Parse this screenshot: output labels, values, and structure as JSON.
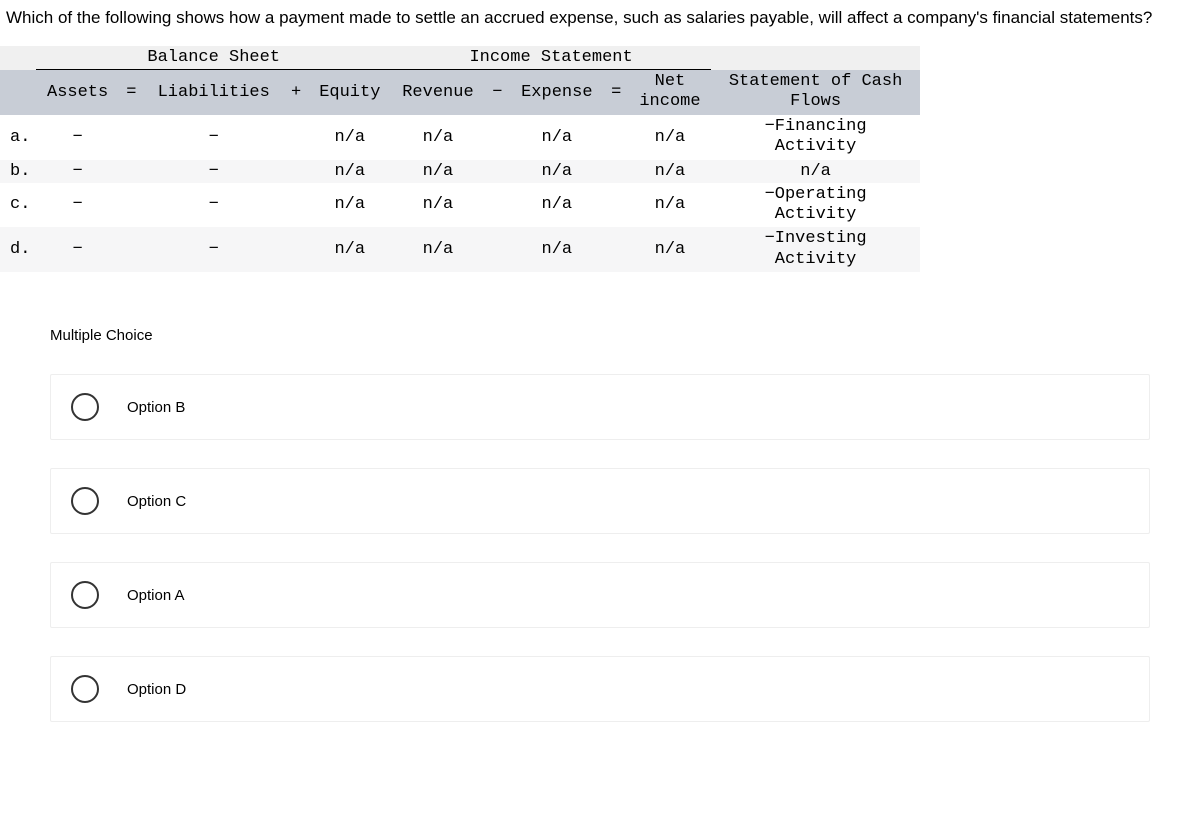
{
  "question": "Which of the following shows how a payment made to settle an accrued expense, such as salaries payable, will affect a company's financial statements?",
  "table": {
    "group_headers": {
      "balance_sheet": "Balance Sheet",
      "income_statement": "Income Statement"
    },
    "columns": {
      "assets": "Assets",
      "eq1": "=",
      "liabilities": "Liabilities",
      "plus": "+",
      "equity": "Equity",
      "revenue": "Revenue",
      "minus": "−",
      "expense": "Expense",
      "eq2": "=",
      "netincome_l1": "Net",
      "netincome_l2": "income",
      "socf_l1": "Statement of Cash",
      "socf_l2": "Flows"
    },
    "rows": [
      {
        "label": "a.",
        "assets": "−",
        "liabilities": "−",
        "equity": "n/a",
        "revenue": "n/a",
        "expense": "n/a",
        "netincome": "n/a",
        "socf_l1": "−Financing",
        "socf_l2": "Activity"
      },
      {
        "label": "b.",
        "assets": "−",
        "liabilities": "−",
        "equity": "n/a",
        "revenue": "n/a",
        "expense": "n/a",
        "netincome": "n/a",
        "socf_l1": "n/a",
        "socf_l2": ""
      },
      {
        "label": "c.",
        "assets": "−",
        "liabilities": "−",
        "equity": "n/a",
        "revenue": "n/a",
        "expense": "n/a",
        "netincome": "n/a",
        "socf_l1": "−Operating",
        "socf_l2": "Activity"
      },
      {
        "label": "d.",
        "assets": "−",
        "liabilities": "−",
        "equity": "n/a",
        "revenue": "n/a",
        "expense": "n/a",
        "netincome": "n/a",
        "socf_l1": "−Investing",
        "socf_l2": "Activity"
      }
    ]
  },
  "mc_heading": "Multiple Choice",
  "options": [
    {
      "label": "Option B"
    },
    {
      "label": "Option C"
    },
    {
      "label": "Option A"
    },
    {
      "label": "Option D"
    }
  ]
}
